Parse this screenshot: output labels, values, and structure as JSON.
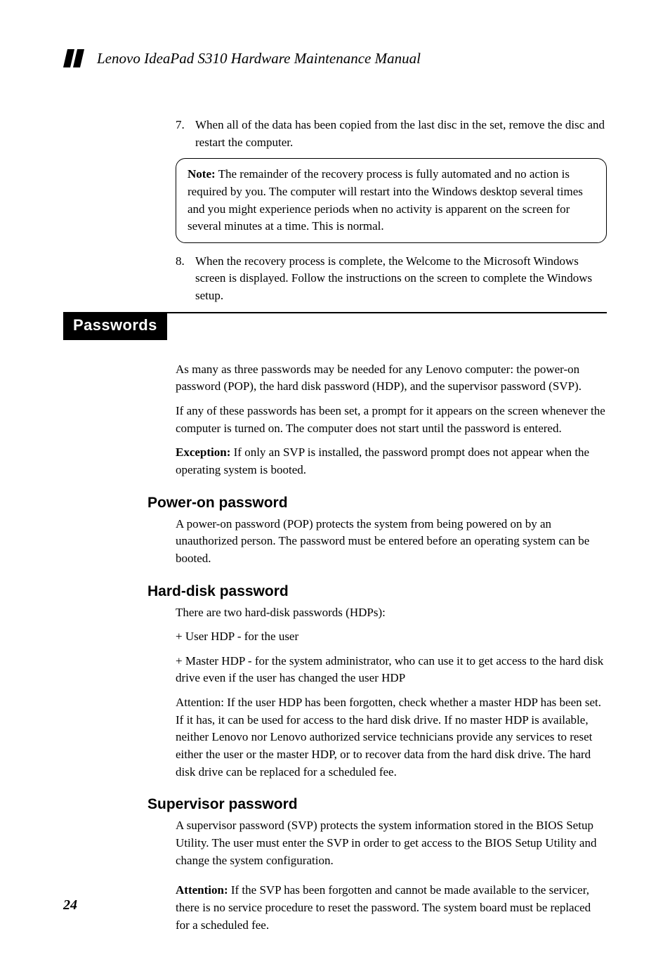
{
  "header": {
    "title": "Lenovo IdeaPad S310 Hardware Maintenance Manual"
  },
  "list": {
    "item7": {
      "num": "7.",
      "text": "When all of the data has been copied from the last disc in the set, remove the disc and restart the computer."
    },
    "item8": {
      "num": "8.",
      "text": "When the recovery process is complete, the Welcome to the Microsoft Windows screen is displayed. Follow the instructions on the screen to complete the Windows setup."
    }
  },
  "noteBox": {
    "lead": "Note:",
    "text": " The remainder of the recovery process is fully automated and no action is required by you. The computer will restart into the Windows desktop several times and you might experience periods when no activity is apparent on the screen for several minutes at a time. This is normal."
  },
  "sectionTab": {
    "title": "Passwords"
  },
  "intro": {
    "p1": "As many as three passwords may be needed for any Lenovo computer: the power-on password (POP), the hard disk password (HDP), and the supervisor password (SVP).",
    "p2": "If any of these passwords has been set, a prompt for it appears on the screen whenever the computer is turned on. The computer does not start until the password is entered.",
    "exceptionLead": "Exception:",
    "exceptionText": " If only an SVP is installed, the password prompt does not appear when the operating system is booted."
  },
  "powerOn": {
    "heading": "Power-on password",
    "p1": "A power-on password (POP) protects the system from being powered on by an unauthorized person. The password must be entered before an operating system can be booted."
  },
  "hardDisk": {
    "heading": "Hard-disk password",
    "p1": "There are two hard-disk passwords (HDPs):",
    "p2": "+ User HDP - for the user",
    "p3": "+ Master HDP - for the system administrator, who can use it to get access to the hard disk drive even if the user has changed the user HDP",
    "p4": "Attention: If the user HDP has been forgotten, check whether a master HDP has been set. If it has, it can be used for access to the hard disk drive. If no master HDP is available, neither Lenovo nor Lenovo authorized service technicians provide any services to reset either the user or the master HDP, or to recover data from the hard disk drive. The hard disk drive can be replaced for a scheduled fee."
  },
  "supervisor": {
    "heading": "Supervisor password",
    "p1": "A supervisor password (SVP) protects the system information stored in the BIOS Setup Utility. The user must enter the SVP in order to get access to the BIOS Setup Utility and change the system configuration.",
    "attentionLead": "Attention:",
    "attentionText": " If the SVP has been forgotten and cannot be made available to the servicer, there is no service procedure to reset the password. The system board must be replaced for a scheduled fee."
  },
  "pageNumber": "24"
}
